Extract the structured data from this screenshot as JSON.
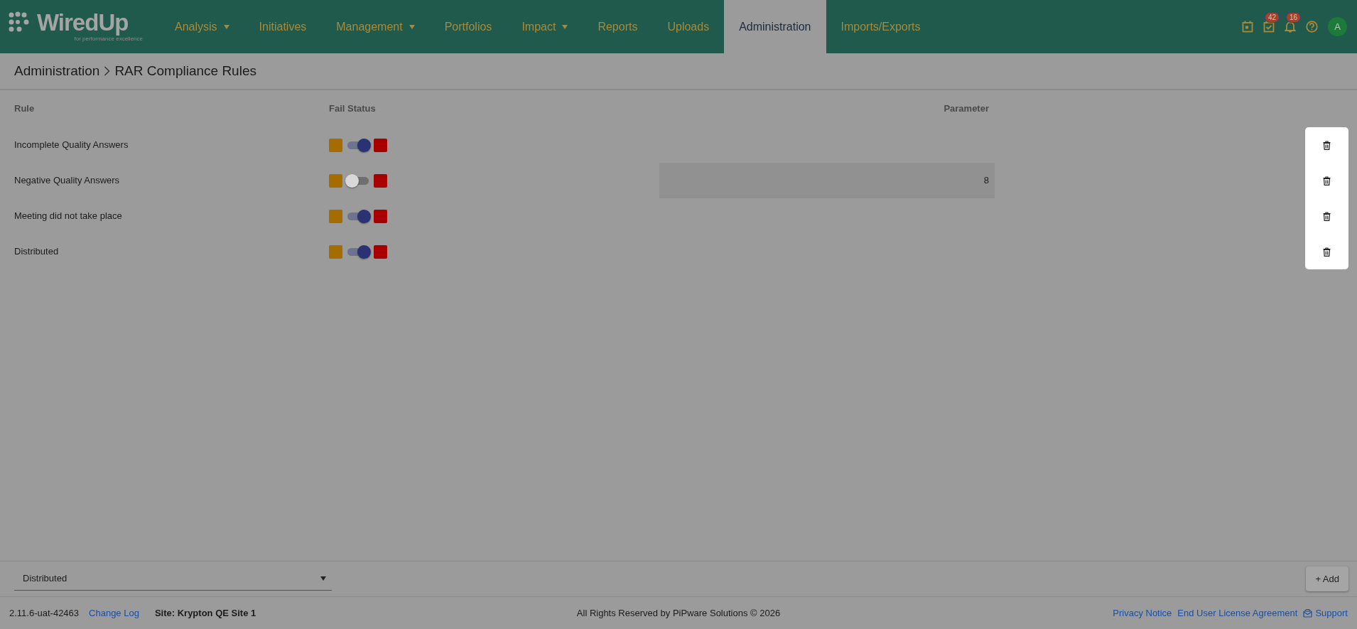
{
  "nav": {
    "logo": {
      "name": "WiredUp",
      "tagline": "for performance excellence"
    },
    "items": [
      {
        "label": "Analysis",
        "dropdown": true,
        "selected": false
      },
      {
        "label": "Initiatives",
        "dropdown": false,
        "selected": false
      },
      {
        "label": "Management",
        "dropdown": true,
        "selected": false
      },
      {
        "label": "Portfolios",
        "dropdown": false,
        "selected": false
      },
      {
        "label": "Impact",
        "dropdown": true,
        "selected": false
      },
      {
        "label": "Reports",
        "dropdown": false,
        "selected": false
      },
      {
        "label": "Uploads",
        "dropdown": false,
        "selected": false
      },
      {
        "label": "Administration",
        "dropdown": false,
        "selected": true
      },
      {
        "label": "Imports/Exports",
        "dropdown": false,
        "selected": false
      }
    ],
    "tools": [
      {
        "kind": "calendar"
      },
      {
        "kind": "tasks",
        "badge": "42"
      },
      {
        "kind": "bell",
        "badge": "16"
      },
      {
        "kind": "help"
      },
      {
        "kind": "avatar",
        "initial": "A"
      }
    ]
  },
  "breadcrumb": [
    "Administration",
    "RAR Compliance Rules"
  ],
  "table": {
    "columns": [
      "Rule",
      "Fail Status",
      "Parameter"
    ],
    "rows": [
      {
        "rule": "Incomplete Quality Answers",
        "on": true
      },
      {
        "rule": "Negative Quality Answers",
        "on": false,
        "parameter": "8"
      },
      {
        "rule": "Meeting did not take place",
        "on": true
      },
      {
        "rule": "Distributed",
        "on": true
      }
    ]
  },
  "add_bar": {
    "select_value": "Distributed",
    "add_button": "+ Add"
  },
  "footer": {
    "version": "2.11.6-uat-42463",
    "change_log": "Change Log",
    "site": "Site: Krypton QE Site 1",
    "copyright": "All Rights Reserved by PiPware Solutions © 2026",
    "links": [
      "Privacy Notice",
      "End User License Agreement"
    ],
    "support": "Support"
  }
}
